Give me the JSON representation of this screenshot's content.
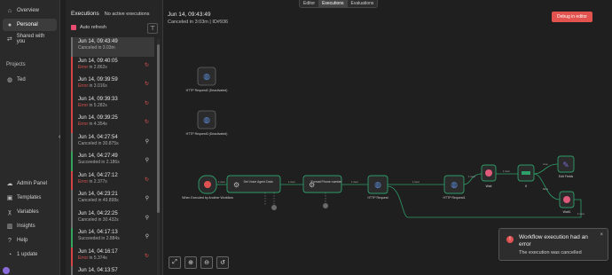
{
  "nav": {
    "items": [
      {
        "label": "Overview",
        "icon": "home-icon"
      },
      {
        "label": "Personal",
        "icon": "user-icon"
      },
      {
        "label": "Shared with you",
        "icon": "share-icon"
      }
    ],
    "projects_label": "Projects",
    "project": {
      "label": "Ted",
      "icon": "globe-icon"
    },
    "bottom": [
      {
        "label": "Admin Panel",
        "icon": "cloud-icon"
      },
      {
        "label": "Templates",
        "icon": "box-icon"
      },
      {
        "label": "Variables",
        "icon": "variable-icon"
      },
      {
        "label": "Insights",
        "icon": "chart-icon"
      },
      {
        "label": "Help",
        "icon": "help-icon"
      },
      {
        "label": "1 update",
        "icon": "bell-icon"
      }
    ],
    "collapse": "‹"
  },
  "executions": {
    "title": "Executions",
    "subtitle": "No active executions",
    "auto_refresh": "Auto refresh",
    "rows": [
      {
        "time": "Jun 14, 09:43:49",
        "status": "Canceled",
        "detail": " in 3.03m",
        "kind": "cancel",
        "active": true,
        "icon": ""
      },
      {
        "time": "Jun 14, 09:40:05",
        "status": "Error",
        "detail": " in 2.862s",
        "kind": "error",
        "icon": "retry-icon"
      },
      {
        "time": "Jun 14, 09:39:59",
        "status": "Error",
        "detail": " in 3.016s",
        "kind": "error",
        "icon": "retry-icon"
      },
      {
        "time": "Jun 14, 09:39:33",
        "status": "Error",
        "detail": " in 5.282s",
        "kind": "error",
        "icon": "retry-icon"
      },
      {
        "time": "Jun 14, 09:39:25",
        "status": "Error",
        "detail": " in 4.354s",
        "kind": "error",
        "icon": "retry-icon"
      },
      {
        "time": "Jun 14, 04:27:54",
        "status": "Canceled",
        "detail": " in 30.875s",
        "kind": "cancel",
        "icon": "user-icon"
      },
      {
        "time": "Jun 14, 04:27:49",
        "status": "Succeeded",
        "detail": " in 2.186s",
        "kind": "success",
        "icon": "user-icon"
      },
      {
        "time": "Jun 14, 04:27:12",
        "status": "Error",
        "detail": " in 2.377s",
        "kind": "error",
        "icon": "retry-icon"
      },
      {
        "time": "Jun 14, 04:23:21",
        "status": "Canceled",
        "detail": " in 49.898s",
        "kind": "cancel",
        "icon": "user-icon"
      },
      {
        "time": "Jun 14, 04:22:25",
        "status": "Canceled",
        "detail": " in 30.432s",
        "kind": "cancel",
        "icon": "user-icon"
      },
      {
        "time": "Jun 14, 04:17:13",
        "status": "Succeeded",
        "detail": " in 2.884s",
        "kind": "success",
        "icon": "user-icon"
      },
      {
        "time": "Jun 14, 04:16:17",
        "status": "Error",
        "detail": " in 5.374s",
        "kind": "error",
        "icon": "retry-icon"
      },
      {
        "time": "Jun 14, 04:13:57",
        "status": "",
        "detail": "",
        "kind": "cancel",
        "icon": ""
      }
    ]
  },
  "tabs": [
    "Editor",
    "Executions",
    "Evaluations"
  ],
  "canvas": {
    "exec_title": "Jun 14, 09:43:49",
    "exec_sub": "Canceled in 3:03m | ID#936",
    "debug_button": "Debug in editor",
    "nodes": [
      {
        "label": "HTTP Request2 (Deactivated)",
        "icon": "globe-icon"
      },
      {
        "label": "HTTP Request3 (Deactivated)",
        "icon": "globe-icon"
      },
      {
        "label": "When Executed by Another Workflow",
        "icon": "trigger-icon"
      },
      {
        "label": "Set Voice Agent Data",
        "icon": "gear-icon"
      },
      {
        "label": "Format Phone number",
        "icon": "gear-icon"
      },
      {
        "label": "HTTP Request",
        "icon": "globe-icon"
      },
      {
        "label": "HTTP Request1",
        "icon": "globe-icon"
      },
      {
        "label": "Wait",
        "icon": "pause-icon"
      },
      {
        "label": "If",
        "icon": "if-icon"
      },
      {
        "label": "Edit Fields",
        "icon": "pencil-icon"
      },
      {
        "label": "Wait1",
        "icon": "pause-icon"
      }
    ],
    "edge_labels": [
      "1 item",
      "1 item",
      "1 item",
      "1 item",
      "1 item",
      "1 item",
      "1 item",
      "true",
      "false"
    ]
  },
  "controls": [
    "fit-view-icon",
    "zoom-in-icon",
    "zoom-out-icon",
    "reset-icon"
  ],
  "toast": {
    "title": "Workflow execution had an error",
    "message": "The execution was cancelled",
    "close": "×"
  },
  "colors": {
    "accent": "#ea4b71",
    "error": "#e05252",
    "success": "#35a55e",
    "node_green": "#2e9e6a"
  }
}
